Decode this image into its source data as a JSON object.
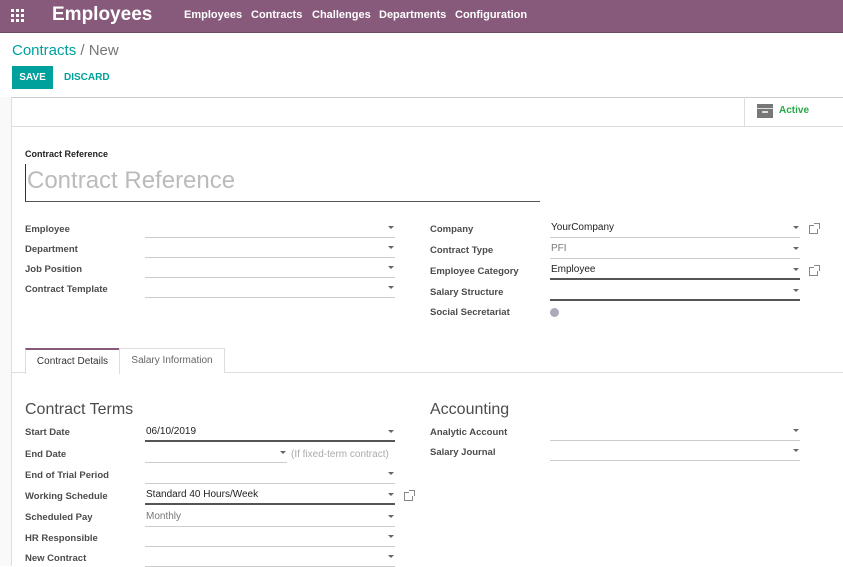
{
  "nav": {
    "app_title": "Employees",
    "menu": [
      "Employees",
      "Contracts",
      "Challenges",
      "Departments",
      "Configuration"
    ],
    "color": "#875A7B"
  },
  "breadcrumb": {
    "parent": "Contracts",
    "sep": "/",
    "current": "New"
  },
  "buttons": {
    "save": "SAVE",
    "discard": "DISCARD"
  },
  "status": {
    "label": "Active",
    "icon": "archive-icon"
  },
  "reference": {
    "label": "Contract Reference",
    "placeholder": "Contract Reference"
  },
  "left": [
    {
      "label": "Employee",
      "value": ""
    },
    {
      "label": "Department",
      "value": ""
    },
    {
      "label": "Job Position",
      "value": ""
    },
    {
      "label": "Contract Template",
      "value": ""
    }
  ],
  "right": [
    {
      "label": "Company",
      "value": "YourCompany"
    },
    {
      "label": "Contract Type",
      "value": "PFI"
    },
    {
      "label": "Employee Category",
      "value": "Employee"
    },
    {
      "label": "Salary Structure",
      "value": ""
    },
    {
      "label": "Social Secretariat",
      "value": ""
    }
  ],
  "tabs": [
    "Contract Details",
    "Salary Information"
  ],
  "terms": {
    "title": "Contract Terms",
    "rows": [
      {
        "label": "Start Date",
        "value": "06/10/2019"
      },
      {
        "label": "End Date",
        "value": "",
        "hint": "(If fixed-term contract)"
      },
      {
        "label": "End of Trial Period",
        "value": ""
      },
      {
        "label": "Working Schedule",
        "value": "Standard 40 Hours/Week"
      },
      {
        "label": "Scheduled Pay",
        "value": "Monthly"
      },
      {
        "label": "HR Responsible",
        "value": ""
      },
      {
        "label": "New Contract",
        "value": ""
      }
    ]
  },
  "accounting": {
    "title": "Accounting",
    "rows": [
      {
        "label": "Analytic Account",
        "value": ""
      },
      {
        "label": "Salary Journal",
        "value": ""
      }
    ]
  }
}
